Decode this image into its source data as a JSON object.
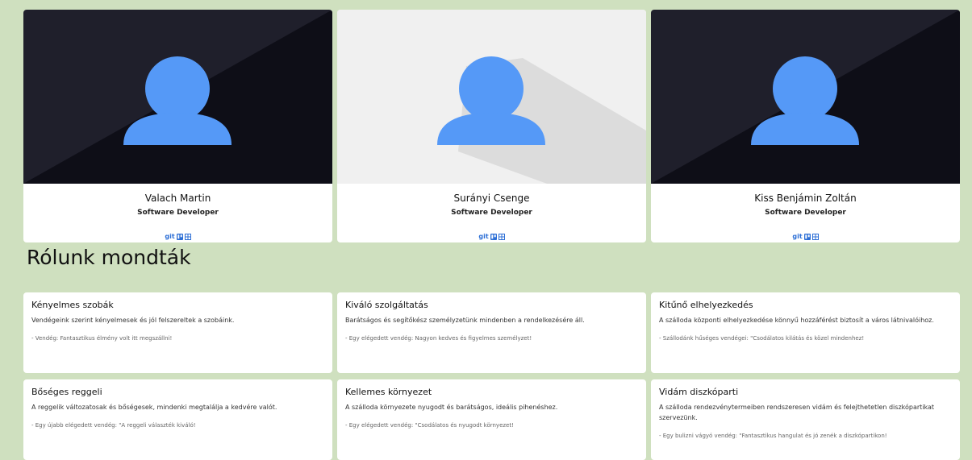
{
  "team": [
    {
      "name": "Valach Martin",
      "role": "Software Developer",
      "links": {
        "git": "git"
      }
    },
    {
      "name": "Surányi Csenge",
      "role": "Software Developer",
      "links": {
        "git": "git"
      }
    },
    {
      "name": "Kiss Benjámin Zoltán",
      "role": "Software Developer",
      "links": {
        "git": "git"
      }
    }
  ],
  "section_title": "Rólunk mondták",
  "reviews": [
    {
      "title": "Kényelmes szobák",
      "desc": "Vendégeink szerint kényelmesek és jól felszereltek a szobáink.",
      "quote": "- Vendég: Fantasztikus élmény volt itt megszállni!"
    },
    {
      "title": "Kiváló szolgáltatás",
      "desc": "Barátságos és segítőkész személyzetünk mindenben a rendelkezésére áll.",
      "quote": "- Egy elégedett vendég: Nagyon kedves és figyelmes személyzet!"
    },
    {
      "title": "Kitűnő elhelyezkedés",
      "desc": "A szálloda központi elhelyezkedése könnyű hozzáférést biztosít a város látnivalóihoz.",
      "quote": "- Szállodánk hűséges vendégei: \"Csodálatos kilátás és közel mindenhez!"
    },
    {
      "title": "Bőséges reggeli",
      "desc": "A reggelik változatosak és bőségesek, mindenki megtalálja a kedvére valót.",
      "quote": "- Egy újabb elégedett vendég: \"A reggeli választék kiváló!"
    },
    {
      "title": "Kellemes környezet",
      "desc": "A szálloda környezete nyugodt és barátságos, ideális pihenéshez.",
      "quote": "- Egy elégedett vendég: \"Csodálatos és nyugodt környezet!"
    },
    {
      "title": "Vidám diszkóparti",
      "desc": "A szálloda rendezvénytermeiben rendszeresen vidám és felejthetetlen diszkópartikat szervezünk.",
      "quote": "- Egy bulizni vágyó vendég: \"Fantasztikus hangulat és jó zenék a diszkópartikon!"
    }
  ],
  "colors": {
    "page_bg": "#cfe0bf",
    "avatar": "#5599f7",
    "dark_photo": "#14141f",
    "light_photo": "#f0f0f0",
    "link": "#2d6fd6"
  }
}
